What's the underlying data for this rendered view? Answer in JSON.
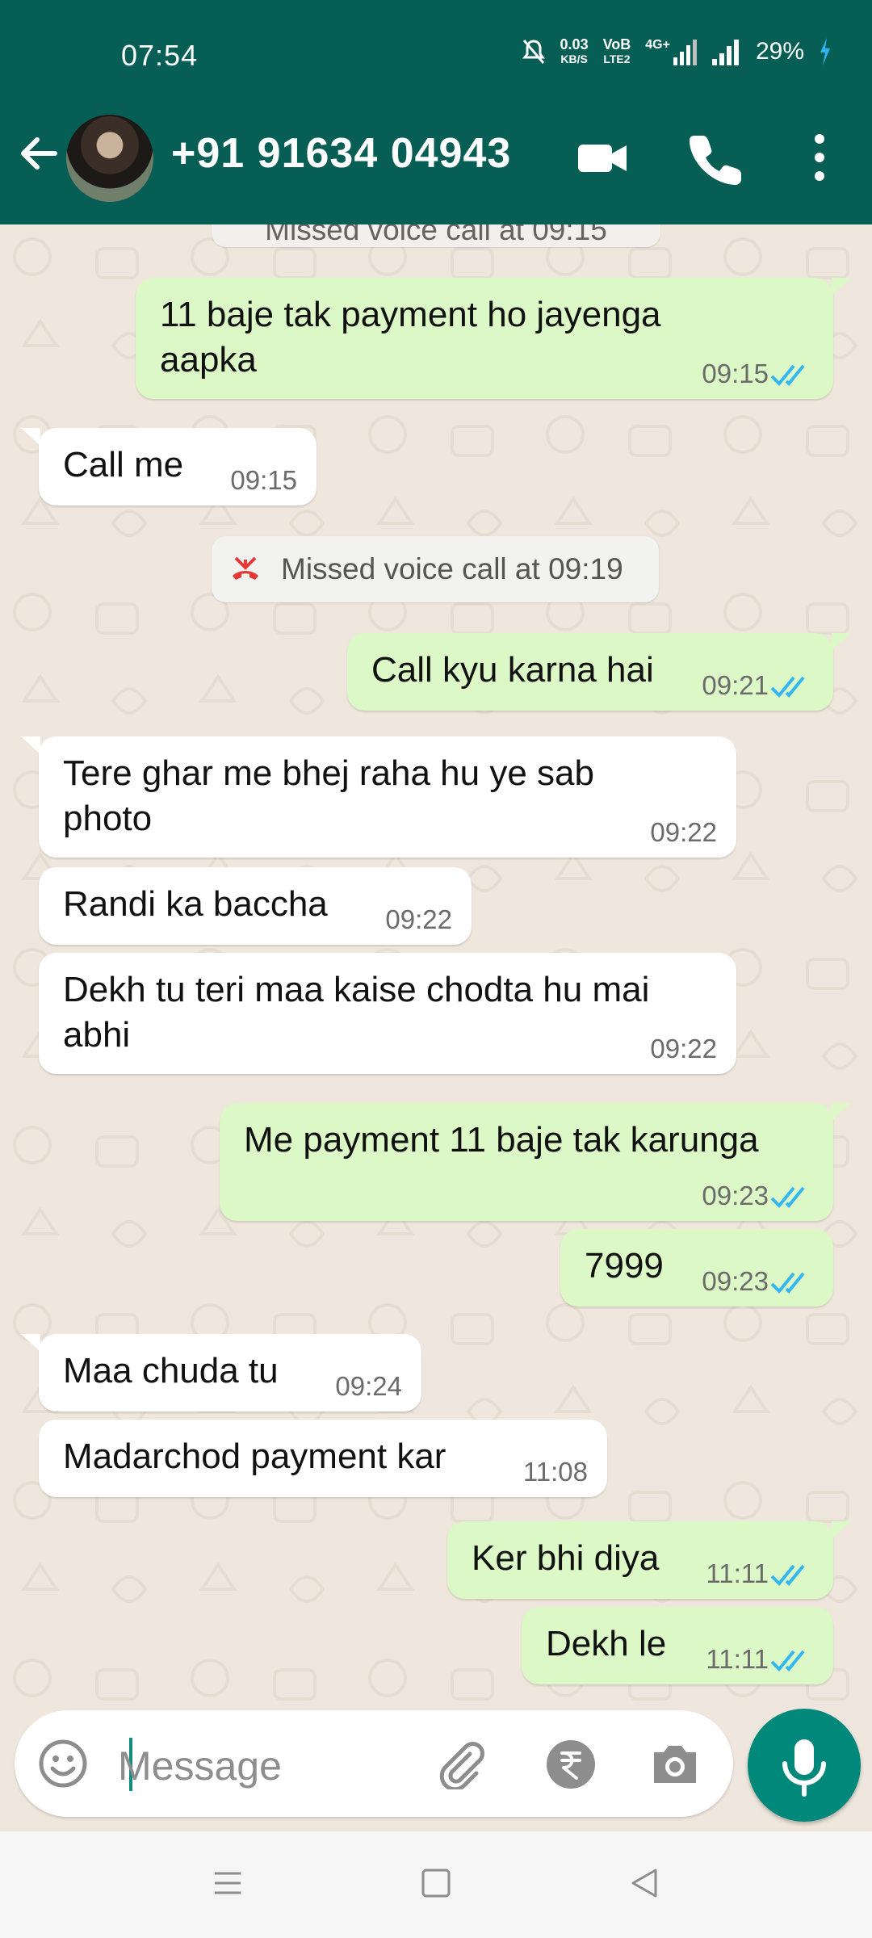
{
  "status": {
    "time": "07:54",
    "net_speed_top": "0.03",
    "net_speed_bottom": "KB/S",
    "volte_top": "VoB",
    "volte_bottom": "LTE2",
    "network": "4G+",
    "battery": "29%"
  },
  "header": {
    "contact": "+91 91634 04943"
  },
  "chat": {
    "partial_top": "Missed voice call at 09:15",
    "messages": [
      {
        "dir": "out",
        "lines": [
          "11 baje tak payment ho jayenga",
          "aapka"
        ],
        "time": "09:15"
      },
      {
        "dir": "in",
        "lines": [
          "Call me"
        ],
        "time": "09:15"
      },
      {
        "dir": "sys",
        "text": "Missed voice call at 09:19"
      },
      {
        "dir": "out",
        "lines": [
          "Call kyu karna hai"
        ],
        "time": "09:21"
      },
      {
        "dir": "in",
        "lines": [
          "Tere ghar me bhej raha hu ye sab",
          "photo"
        ],
        "time": "09:22"
      },
      {
        "dir": "in",
        "lines": [
          "Randi ka baccha"
        ],
        "time": "09:22"
      },
      {
        "dir": "in",
        "lines": [
          "Dekh tu teri maa kaise chodta hu mai",
          "abhi"
        ],
        "time": "09:22"
      },
      {
        "dir": "out",
        "lines": [
          "Me payment 11 baje tak karunga"
        ],
        "time": "09:23"
      },
      {
        "dir": "out",
        "lines": [
          "7999"
        ],
        "time": "09:23"
      },
      {
        "dir": "in",
        "lines": [
          "Maa chuda tu"
        ],
        "time": "09:24"
      },
      {
        "dir": "in",
        "lines": [
          "Madarchod payment kar"
        ],
        "time": "11:08"
      },
      {
        "dir": "out",
        "lines": [
          "Ker bhi diya"
        ],
        "time": "11:11"
      },
      {
        "dir": "out",
        "lines": [
          "Dekh le"
        ],
        "time": "11:11"
      }
    ]
  },
  "composer": {
    "placeholder": "Message"
  },
  "colors": {
    "header": "#075e54",
    "outgoing": "#dcf8c6",
    "incoming": "#ffffff",
    "tick_read": "#34b7f1",
    "mic": "#00897b",
    "missed_call": "#e53935"
  }
}
